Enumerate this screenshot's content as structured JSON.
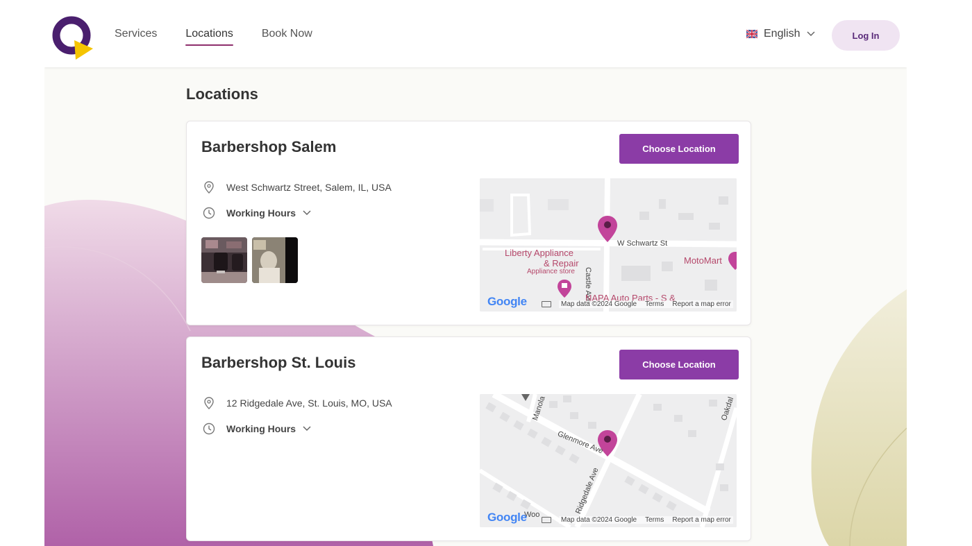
{
  "header": {
    "nav": [
      "Services",
      "Locations",
      "Book Now"
    ],
    "language": "English",
    "login_label": "Log In"
  },
  "page": {
    "title": "Locations"
  },
  "locations": [
    {
      "name": "Barbershop Salem",
      "button_label": "Choose Location",
      "address": "West Schwartz Street, Salem, IL, USA",
      "hours_label": "Working Hours",
      "map": {
        "labels": [
          "W Schwartz St",
          "Castle Ave",
          "Liberty Appliance",
          "& Repair",
          "Appliance store",
          "MotoMart",
          "NAPA Auto Parts - S &"
        ],
        "google": "Google",
        "map_data": "Map data ©2024 Google",
        "terms": "Terms",
        "report": "Report a map error"
      }
    },
    {
      "name": "Barbershop St. Louis",
      "button_label": "Choose Location",
      "address": "12 Ridgedale Ave, St. Louis, MO, USA",
      "hours_label": "Working Hours",
      "map": {
        "labels": [
          "Glenmore Ave",
          "Ridgedale Ave",
          "Manola",
          "Oakdal",
          "Woo"
        ],
        "google": "Google",
        "map_data": "Map data ©2024 Google",
        "terms": "Terms",
        "report": "Report a map error"
      }
    }
  ],
  "colors": {
    "brand_purple": "#8b3ca6",
    "logo_purple": "#4a1f6e",
    "logo_yellow": "#f5c400",
    "login_bg": "#f0e4f2",
    "active_underline": "#8e2f6c",
    "map_pin": "#c2449a"
  }
}
